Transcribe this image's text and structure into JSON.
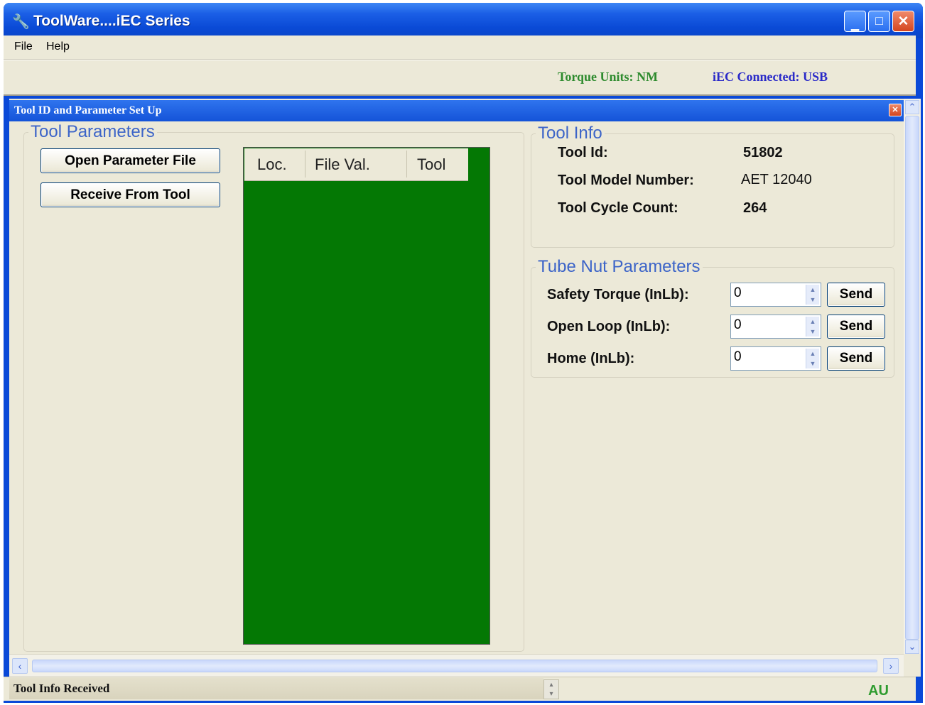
{
  "window": {
    "title": "ToolWare....iEC Series",
    "icon": "wrench-icon"
  },
  "menu": {
    "items": [
      "File",
      "Help"
    ]
  },
  "infobar": {
    "torque_units": "Torque Units: NM",
    "connection": "iEC Connected: USB"
  },
  "child_window": {
    "title": "Tool ID and Parameter Set Up"
  },
  "tool_parameters": {
    "legend": "Tool Parameters",
    "open_button": "Open Parameter File",
    "receive_button": "Receive From Tool",
    "grid": {
      "columns": [
        "Loc.",
        "File Val.",
        "Tool"
      ],
      "rows": []
    }
  },
  "tool_info": {
    "legend": "Tool Info",
    "id_label": "Tool Id:",
    "id_value": "51802",
    "model_label": "Tool Model Number:",
    "model_value": "AET 12040",
    "cycle_label": "Tool Cycle Count:",
    "cycle_value": "264"
  },
  "tube_nut": {
    "legend": "Tube Nut Parameters",
    "rows": [
      {
        "label": "Safety Torque (InLb):",
        "value": "0",
        "button": "Send"
      },
      {
        "label": "Open Loop (InLb):",
        "value": "0",
        "button": "Send"
      },
      {
        "label": "Home (InLb):",
        "value": "0",
        "button": "Send"
      }
    ]
  },
  "statusbar": {
    "message": "Tool Info Received",
    "indicator": "AU"
  },
  "colors": {
    "title_blue": "#0a4ad6",
    "grid_green": "#047804",
    "torque_green": "#2e8b2e",
    "connected_blue": "#2a2ac8",
    "legend_blue": "#3c64c8",
    "face": "#ece9d8"
  }
}
